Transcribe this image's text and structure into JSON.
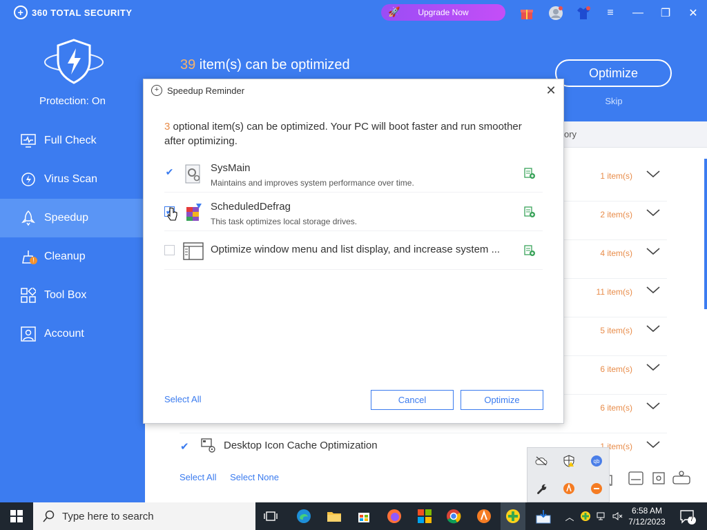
{
  "app": {
    "title": "360 TOTAL SECURITY",
    "protection": "Protection: On",
    "upgrade": "Upgrade Now"
  },
  "colors": {
    "primary": "#3c7cf0",
    "active_nav": "#5a95f5",
    "accent_orange": "#e88b48",
    "link_blue": "#3a7bef"
  },
  "sidebar": {
    "items": [
      {
        "label": "Full Check",
        "icon": "monitor-pulse-icon"
      },
      {
        "label": "Virus Scan",
        "icon": "virus-scan-icon"
      },
      {
        "label": "Speedup",
        "icon": "rocket-icon",
        "active": true
      },
      {
        "label": "Cleanup",
        "icon": "broom-icon"
      },
      {
        "label": "Tool Box",
        "icon": "toolbox-icon"
      },
      {
        "label": "Account",
        "icon": "account-icon"
      }
    ]
  },
  "header": {
    "count": "39",
    "count_text": " item(s) can be optimized",
    "optimize": "Optimize",
    "skip": "Skip",
    "category_partial": "ory"
  },
  "rows": [
    {
      "count": "1 item(s)"
    },
    {
      "count": "2 item(s)"
    },
    {
      "count": "4 item(s)"
    },
    {
      "count": "11 item(s)"
    },
    {
      "count": "5 item(s)"
    },
    {
      "count": "6 item(s)"
    },
    {
      "count": "6 item(s)"
    },
    {
      "count": "1 item(s)",
      "label": "Desktop Icon Cache Optimization"
    }
  ],
  "bottom": {
    "select_all": "Select All",
    "select_none": "Select None"
  },
  "dialog": {
    "title": "Speedup Reminder",
    "count": "3",
    "message": " optional item(s) can be optimized. Your PC will boot faster and run smoother after optimizing.",
    "items": [
      {
        "name": "SysMain",
        "desc": "Maintains and improves system performance over time.",
        "checked": true
      },
      {
        "name": "ScheduledDefrag",
        "desc": "This task optimizes local storage drives.",
        "checked": true
      },
      {
        "name": "Optimize window menu and list display, and increase system ...",
        "desc": "",
        "checked": false
      }
    ],
    "select_all": "Select All",
    "cancel": "Cancel",
    "optimize": "Optimize"
  },
  "taskbar": {
    "search_placeholder": "Type here to search",
    "time": "6:58 AM",
    "date": "7/12/2023",
    "notifications": "7"
  }
}
